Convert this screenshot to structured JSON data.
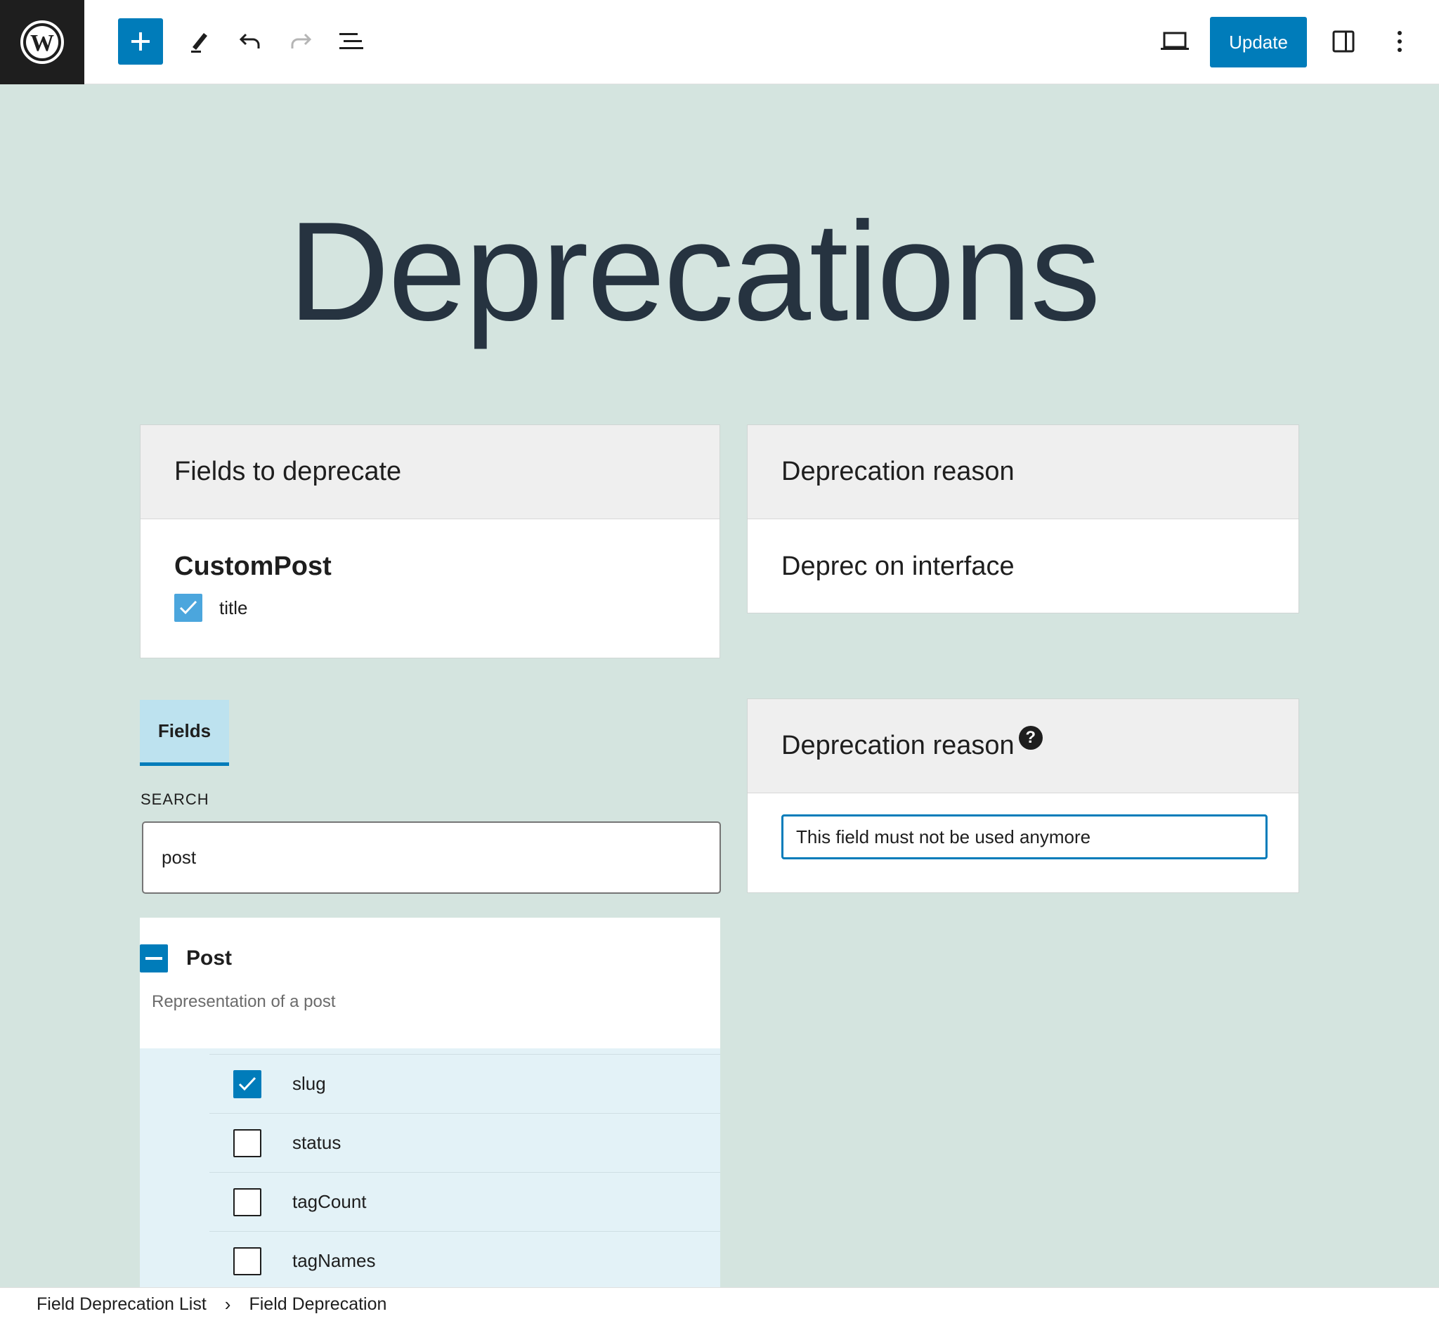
{
  "toolbar": {
    "logo_icon": "wordpress-logo-icon",
    "add_icon": "plus-icon",
    "edit_icon": "pencil-icon",
    "undo_icon": "undo-icon",
    "redo_icon": "redo-icon",
    "outline_icon": "list-view-icon",
    "preview_icon": "laptop-icon",
    "settings_icon": "sidebar-toggle-icon",
    "more_icon": "vertical-ellipsis-icon",
    "update_label": "Update",
    "accent_color": "#007cba"
  },
  "page": {
    "title": "Deprecations",
    "background_color": "#d4e4df"
  },
  "fields_card": {
    "header": "Fields to deprecate",
    "entity": "CustomPost",
    "items": [
      {
        "label": "title",
        "checked": true
      }
    ]
  },
  "reason_card": {
    "header": "Deprecation reason",
    "value": "Deprec on interface"
  },
  "reason_edit_card": {
    "header": "Deprecation reason",
    "help_icon": "question-mark-icon",
    "help_glyph": "?",
    "input_value": "This field must not be used anymore"
  },
  "fields_tab": {
    "label": "Fields"
  },
  "search": {
    "label": "SEARCH",
    "value": "post"
  },
  "type_group": {
    "name": "Post",
    "description": "Representation of a post",
    "collapse_icon": "minus-icon",
    "fields": [
      {
        "label": "slug",
        "checked": true
      },
      {
        "label": "status",
        "checked": false
      },
      {
        "label": "tagCount",
        "checked": false
      },
      {
        "label": "tagNames",
        "checked": false
      }
    ]
  },
  "breadcrumb": {
    "items": [
      "Field Deprecation List",
      "Field Deprecation"
    ],
    "separator": "›"
  }
}
